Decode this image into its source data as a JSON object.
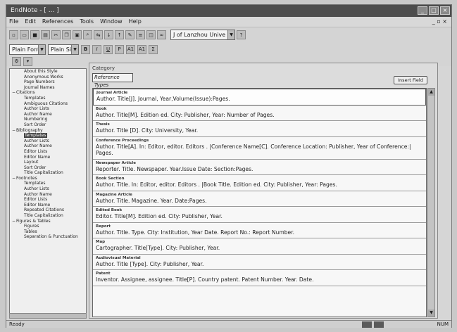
{
  "window": {
    "title": "EndNote - [ ... ]"
  },
  "menu": [
    "File",
    "Edit",
    "References",
    "Tools",
    "Window",
    "Help"
  ],
  "toolbar": {
    "library_combo": "J of Lanzhou Unive",
    "help_button": "?",
    "font_combo": "Plain Font",
    "size_combo": "Plain Size",
    "format_buttons": [
      "B",
      "I",
      "U",
      "P",
      "A1",
      "A1",
      "Σ"
    ]
  },
  "tree": {
    "items": [
      {
        "label": "About this Style",
        "level": 1,
        "expander": ""
      },
      {
        "label": "Anonymous Works",
        "level": 1,
        "expander": ""
      },
      {
        "label": "Page Numbers",
        "level": 1,
        "expander": ""
      },
      {
        "label": "Journal Names",
        "level": 1,
        "expander": ""
      },
      {
        "label": "Citations",
        "level": 0,
        "expander": "−"
      },
      {
        "label": "Templates",
        "level": 1,
        "expander": ""
      },
      {
        "label": "Ambiguous Citations",
        "level": 1,
        "expander": ""
      },
      {
        "label": "Author Lists",
        "level": 1,
        "expander": ""
      },
      {
        "label": "Author Name",
        "level": 1,
        "expander": ""
      },
      {
        "label": "Numbering",
        "level": 1,
        "expander": ""
      },
      {
        "label": "Sort Order",
        "level": 1,
        "expander": ""
      },
      {
        "label": "Bibliography",
        "level": 0,
        "expander": "−"
      },
      {
        "label": "Templates",
        "level": 1,
        "expander": "",
        "selected": true
      },
      {
        "label": "Author Lists",
        "level": 1,
        "expander": ""
      },
      {
        "label": "Author Name",
        "level": 1,
        "expander": ""
      },
      {
        "label": "Editor Lists",
        "level": 1,
        "expander": ""
      },
      {
        "label": "Editor Name",
        "level": 1,
        "expander": ""
      },
      {
        "label": "Layout",
        "level": 1,
        "expander": ""
      },
      {
        "label": "Sort Order",
        "level": 1,
        "expander": ""
      },
      {
        "label": "Title Capitalization",
        "level": 1,
        "expander": ""
      },
      {
        "label": "Footnotes",
        "level": 0,
        "expander": "−"
      },
      {
        "label": "Templates",
        "level": 1,
        "expander": ""
      },
      {
        "label": "Author Lists",
        "level": 1,
        "expander": ""
      },
      {
        "label": "Author Name",
        "level": 1,
        "expander": ""
      },
      {
        "label": "Editor Lists",
        "level": 1,
        "expander": ""
      },
      {
        "label": "Editor Name",
        "level": 1,
        "expander": ""
      },
      {
        "label": "Repeated Citations",
        "level": 1,
        "expander": ""
      },
      {
        "label": "Title Capitalization",
        "level": 1,
        "expander": ""
      },
      {
        "label": "Figures & Tables",
        "level": 0,
        "expander": "−"
      },
      {
        "label": "Figures",
        "level": 1,
        "expander": ""
      },
      {
        "label": "Tables",
        "level": 1,
        "expander": ""
      },
      {
        "label": "Separation & Punctuation",
        "level": 1,
        "expander": ""
      }
    ]
  },
  "pane": {
    "category_label": "Category",
    "category_value": "Reference Types",
    "insert_field_button": "Insert Field"
  },
  "templates": [
    {
      "type": "Journal Article",
      "template": "Author. Title[J]. Journal, Year,Volume(Issue):Pages."
    },
    {
      "type": "Book",
      "template": "Author. Title[M]. Edition ed. City: Publisher, Year: Number of Pages."
    },
    {
      "type": "Thesis",
      "template": "Author. Title [D]. City: University, Year."
    },
    {
      "type": "Conference Proceedings",
      "template": "Author. Title[A]. In: Editor, editor. Editors . |Conference Name[C]. Conference Location: Publisher, Year of Conference:| Pages."
    },
    {
      "type": "Newspaper Article",
      "template": "Reporter. Title. Newspaper. Year.Issue Date: Section:Pages."
    },
    {
      "type": "Book Section",
      "template": "Author. Title. In: Editor, editor. Editors . |Book Title. Edition ed. City: Publisher, Year: Pages."
    },
    {
      "type": "Magazine Article",
      "template": "Author. Title. Magazine. Year. Date:Pages."
    },
    {
      "type": "Edited Book",
      "template": "Editor. Title[M]. Edition ed. City: Publisher, Year."
    },
    {
      "type": "Report",
      "template": "Author. Title. Type. City: Institution, Year Date. Report No.: Report Number."
    },
    {
      "type": "Map",
      "template": "Cartographer. Title[Type]. City: Publisher, Year."
    },
    {
      "type": "Audiovisual Material",
      "template": "Author. Title [Type]. City: Publisher, Year."
    },
    {
      "type": "Patent",
      "template": "Inventor. Assignee, assignee. Title[P]. Country patent. Patent Number. Year. Date."
    }
  ],
  "status": {
    "left": "Ready",
    "right": "NUM"
  },
  "colors": {
    "titlebar": "#4d4d4d",
    "selection": "#444444",
    "chrome": "#d6d6d6"
  }
}
